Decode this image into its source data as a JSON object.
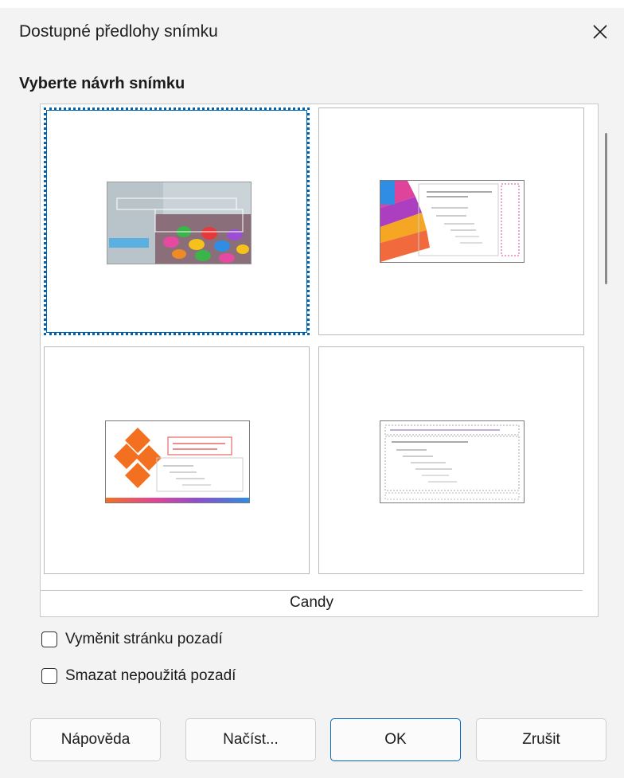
{
  "dialog": {
    "title": "Dostupné předlohy snímku"
  },
  "section": {
    "heading": "Vyberte návrh snímku"
  },
  "gallery": {
    "caption": "Candy",
    "thumbnails": [
      {
        "name": "candy",
        "selected": true
      },
      {
        "name": "pink-stripes",
        "selected": false
      },
      {
        "name": "orange-diamonds",
        "selected": false
      },
      {
        "name": "outline-plain",
        "selected": false
      }
    ]
  },
  "options": {
    "replace_background": "Vyměnit stránku pozadí",
    "delete_unused": "Smazat nepoužitá pozadí"
  },
  "buttons": {
    "help": "Nápověda",
    "load": "Načíst...",
    "ok": "OK",
    "cancel": "Zrušit"
  },
  "colors": {
    "accent": "#0063b1",
    "dialog_bg": "#f3f3f3"
  }
}
